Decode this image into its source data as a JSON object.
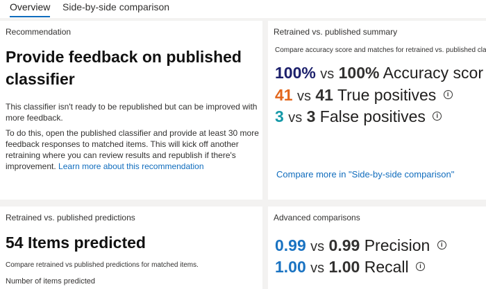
{
  "tabs": {
    "overview": "Overview",
    "comparison": "Side-by-side comparison"
  },
  "recommendation": {
    "section_title": "Recommendation",
    "heading": "Provide feedback on published classifier",
    "p1": "This classifier isn't ready to be republished but can be improved with more feedback.",
    "p2": "To do this, open the published classifier and provide at least 30 more feedback responses to matched items. This will kick off another retraining where you can review results and republish if there's improvement.",
    "link": "Learn more about this recommendation"
  },
  "summary": {
    "section_title": "Retrained vs. published summary",
    "subtitle": "Compare accuracy score and matches for retrained vs. published cla",
    "vs_label": "vs",
    "info_glyph": "i",
    "accuracy": {
      "retrained": "100%",
      "published": "100%",
      "label": "Accuracy scor"
    },
    "true_pos": {
      "retrained": "41",
      "published": "41",
      "label": "True positives"
    },
    "false_pos": {
      "retrained": "3",
      "published": "3",
      "label": "False positives"
    },
    "compare_link": "Compare more in \"Side-by-side comparison\""
  },
  "predictions": {
    "section_title": "Retrained vs. published predictions",
    "heading": "54 Items predicted",
    "subtitle": "Compare retrained vs published predictions for matched items.",
    "cut_text": "Number of items predicted"
  },
  "advanced": {
    "section_title": "Advanced comparisons",
    "precision": {
      "retrained": "0.99",
      "published": "0.99",
      "label": "Precision"
    },
    "recall": {
      "retrained": "1.00",
      "published": "1.00",
      "label": "Recall"
    }
  },
  "colors": {
    "accent": "#0f6cbd",
    "accuracy_number": "#1b1f6b",
    "true_positive_number": "#e3661b",
    "false_positive_number": "#1599a8",
    "advanced_number": "#1a73c2"
  }
}
